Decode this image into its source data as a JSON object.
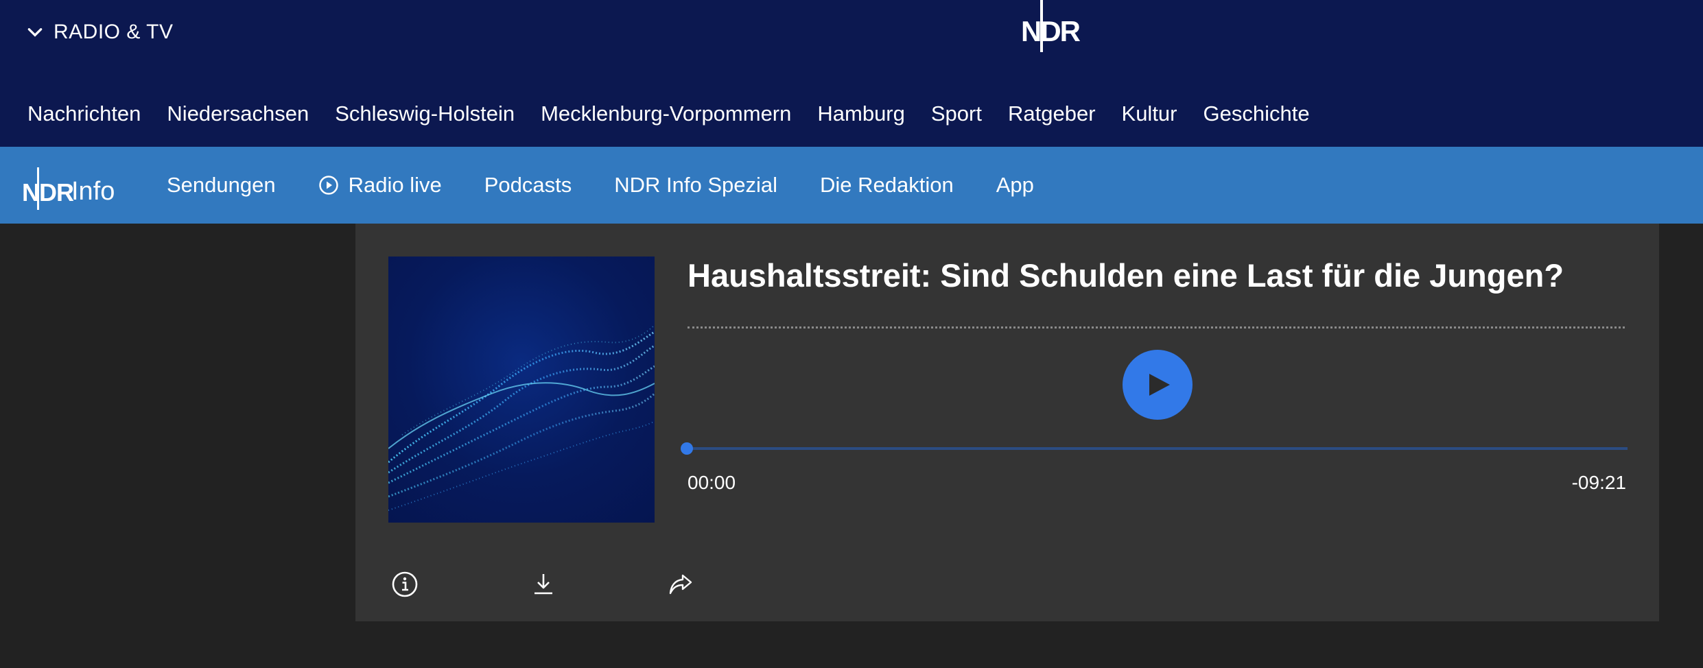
{
  "header": {
    "menu_label": "RADIO & TV",
    "logo_text": "NDR",
    "nav": [
      "Nachrichten",
      "Niedersachsen",
      "Schleswig-Holstein",
      "Mecklenburg-Vorpommern",
      "Hamburg",
      "Sport",
      "Ratgeber",
      "Kultur",
      "Geschichte"
    ]
  },
  "subheader": {
    "logo_text": "NDR",
    "logo_suffix": "Info",
    "nav": [
      {
        "label": "Sendungen",
        "icon": null
      },
      {
        "label": "Radio live",
        "icon": "play-circle-icon"
      },
      {
        "label": "Podcasts",
        "icon": null
      },
      {
        "label": "NDR Info Spezial",
        "icon": null
      },
      {
        "label": "Die Redaktion",
        "icon": null
      },
      {
        "label": "App",
        "icon": null
      }
    ]
  },
  "player": {
    "title": "Haushaltsstreit: Sind Schulden eine Last für die Jungen?",
    "time_current": "00:00",
    "time_remaining": "-09:21",
    "progress": 0,
    "actions": [
      "info-icon",
      "download-icon",
      "share-icon"
    ]
  },
  "colors": {
    "header_bg": "#0c1850",
    "subheader_bg": "#3279bf",
    "page_bg": "#222222",
    "card_bg": "#343434",
    "accent": "#3279e8"
  }
}
